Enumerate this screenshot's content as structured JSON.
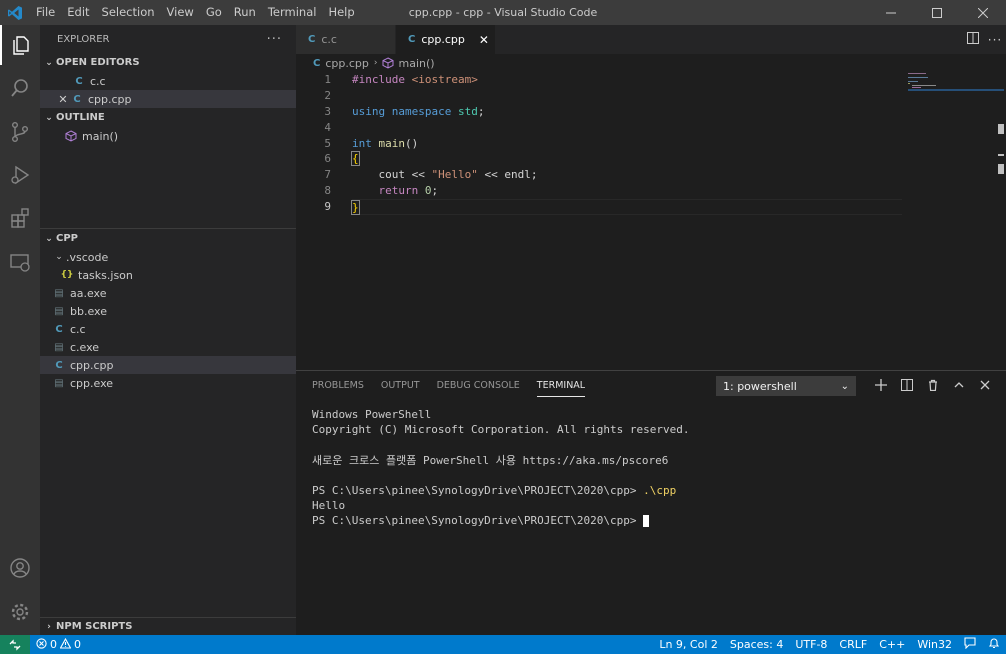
{
  "window": {
    "title": "cpp.cpp - cpp - Visual Studio Code",
    "menu": [
      "File",
      "Edit",
      "Selection",
      "View",
      "Go",
      "Run",
      "Terminal",
      "Help"
    ]
  },
  "sidebar": {
    "header": "EXPLORER",
    "open_editors": {
      "title": "OPEN EDITORS",
      "items": [
        {
          "icon": "C",
          "label": "c.c",
          "selected": false
        },
        {
          "icon": "C",
          "label": "cpp.cpp",
          "selected": true
        }
      ]
    },
    "outline": {
      "title": "OUTLINE",
      "items": [
        {
          "label": "main()"
        }
      ]
    },
    "folder": {
      "title": "CPP",
      "items": [
        {
          "label": ".vscode",
          "type": "folder"
        },
        {
          "label": "tasks.json",
          "type": "json"
        },
        {
          "label": "aa.exe",
          "type": "exe"
        },
        {
          "label": "bb.exe",
          "type": "exe"
        },
        {
          "label": "c.c",
          "type": "c"
        },
        {
          "label": "c.exe",
          "type": "exe"
        },
        {
          "label": "cpp.cpp",
          "type": "cpp"
        },
        {
          "label": "cpp.exe",
          "type": "exe"
        }
      ]
    },
    "npm_scripts": "NPM SCRIPTS"
  },
  "tabs": [
    {
      "label": "c.c",
      "active": false
    },
    {
      "label": "cpp.cpp",
      "active": true
    }
  ],
  "breadcrumb": {
    "file": "cpp.cpp",
    "symbol": "main()"
  },
  "editor": {
    "line_numbers": [
      "1",
      "2",
      "3",
      "4",
      "5",
      "6",
      "7",
      "8",
      "9"
    ],
    "current_line": 9,
    "lines": [
      "#include <iostream>",
      "",
      "using namespace std;",
      "",
      "int main()",
      "{",
      "    cout << \"Hello\" << endl;",
      "    return 0;",
      "}"
    ]
  },
  "panel": {
    "tabs": [
      "PROBLEMS",
      "OUTPUT",
      "DEBUG CONSOLE",
      "TERMINAL"
    ],
    "active_tab": "TERMINAL",
    "terminal_select": "1: powershell",
    "terminal_lines": [
      "Windows PowerShell",
      "Copyright (C) Microsoft Corporation. All rights reserved.",
      "",
      "새로운 크로스 플랫폼 PowerShell 사용 https://aka.ms/pscore6",
      "",
      "PS C:\\Users\\pinee\\SynologyDrive\\PROJECT\\2020\\cpp> ",
      "Hello",
      "PS C:\\Users\\pinee\\SynologyDrive\\PROJECT\\2020\\cpp> "
    ],
    "command": ".\\cpp"
  },
  "status": {
    "errors": "0",
    "warnings": "0",
    "position": "Ln 9, Col 2",
    "spaces": "Spaces: 4",
    "encoding": "UTF-8",
    "eol": "CRLF",
    "language": "C++",
    "platform": "Win32"
  },
  "colors": {
    "accent": "#007acc",
    "remote": "#16825d",
    "titlebar": "#3c3c3c",
    "sidebar": "#252526",
    "editor": "#1e1e1e"
  }
}
